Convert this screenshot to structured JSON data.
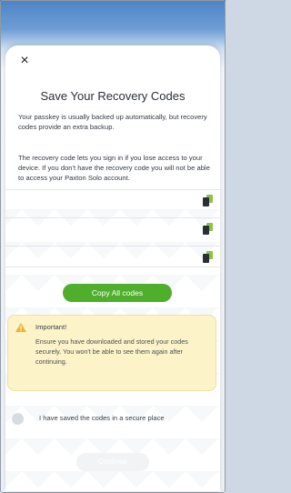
{
  "modal": {
    "close_glyph": "×",
    "title": "Save Your Recovery Codes",
    "intro": "Your passkey is usually backed up automatically, but recovery codes provide an extra backup.",
    "explanation": "The recovery code lets you sign in if you lose access to your device. If you don't have the recovery code you will not be able to access your Paxton Solo account."
  },
  "codes": [
    {
      "value": "",
      "icon": "copy-icon"
    },
    {
      "value": "",
      "icon": "copy-icon"
    },
    {
      "value": "",
      "icon": "copy-icon"
    }
  ],
  "actions": {
    "copy_all_label": "Copy All codes",
    "continue_label": "Continue"
  },
  "warning": {
    "icon": "warning-icon",
    "title": "Important!",
    "text": "Ensure you have downloaded and stored your codes securely. You won't be able to see them again after continuing."
  },
  "confirm": {
    "label": "I have saved the codes in a secure place",
    "checked": false
  },
  "colors": {
    "accent_green": "#4fae2b",
    "warning_bg": "#fdf3c9",
    "warning_icon": "#f0b429",
    "header_blue": "#4d82c4"
  }
}
